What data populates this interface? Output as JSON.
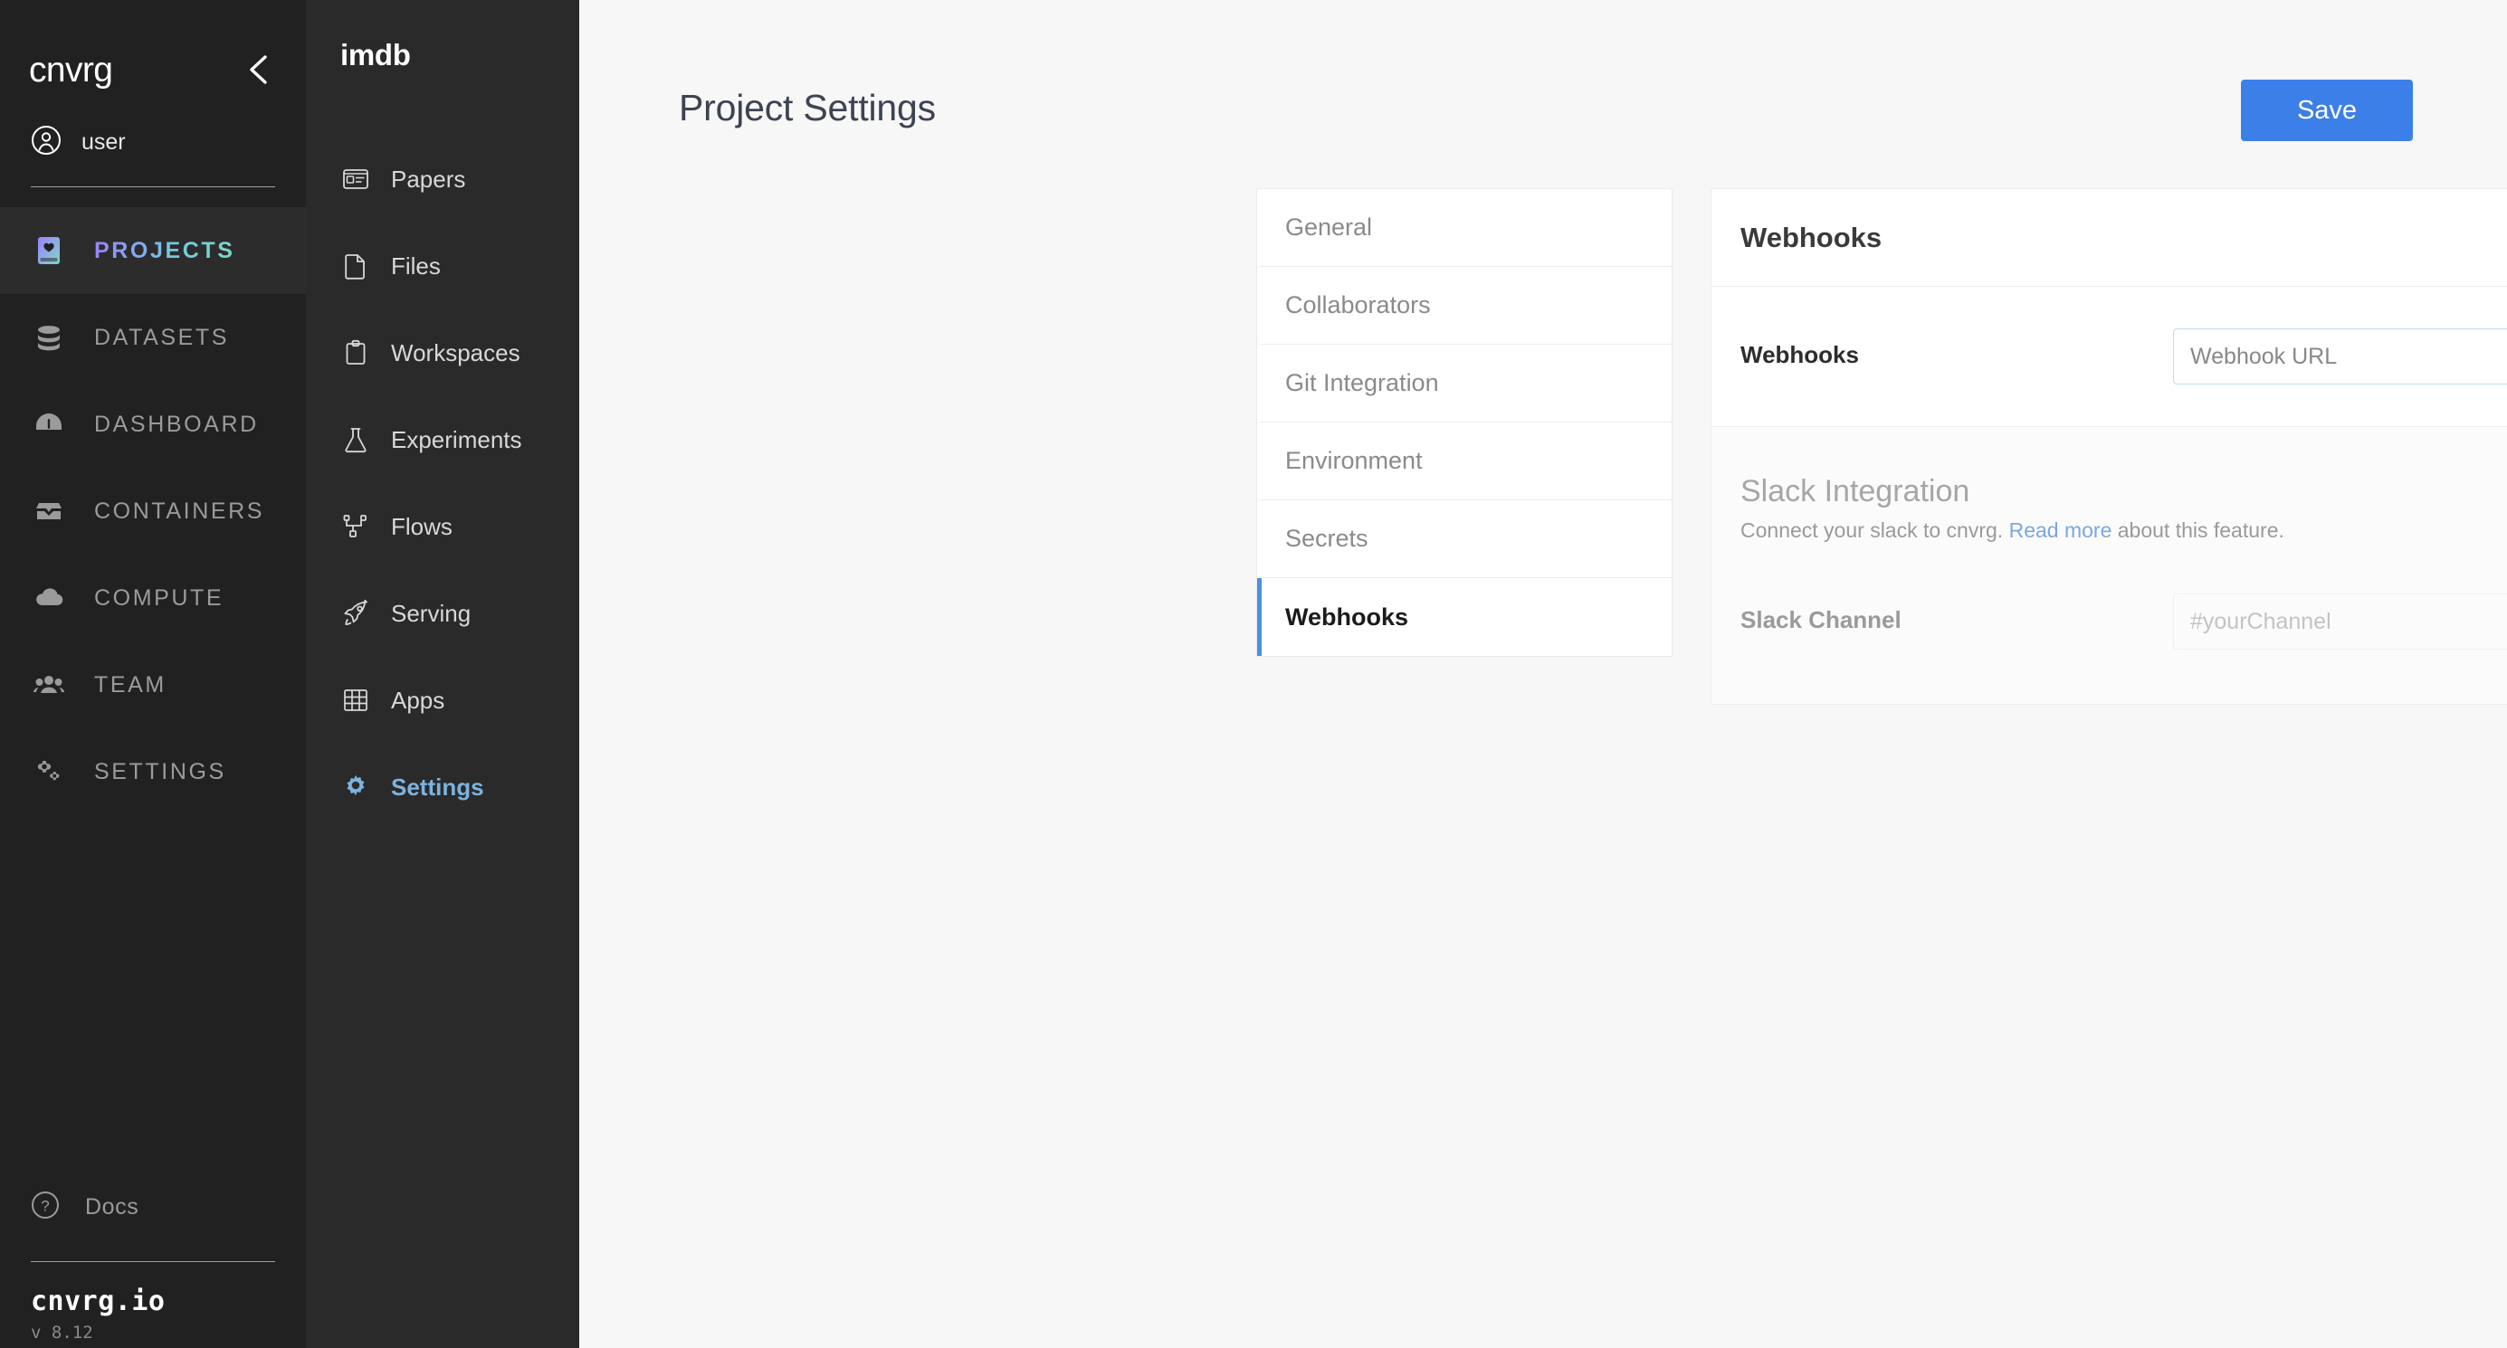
{
  "primary_nav": {
    "brand": "cnvrg",
    "collapse_icon": "chevron-left-icon",
    "user": {
      "icon": "user-circle-icon",
      "name": "user"
    },
    "items": [
      {
        "label": "PROJECTS",
        "icon": "book-heart-icon",
        "active": true
      },
      {
        "label": "DATASETS",
        "icon": "database-icon",
        "active": false
      },
      {
        "label": "DASHBOARD",
        "icon": "gauge-icon",
        "active": false
      },
      {
        "label": "CONTAINERS",
        "icon": "open-box-icon",
        "active": false
      },
      {
        "label": "COMPUTE",
        "icon": "cloud-icon",
        "active": false
      },
      {
        "label": "TEAM",
        "icon": "people-icon",
        "active": false
      },
      {
        "label": "SETTINGS",
        "icon": "gears-icon",
        "active": false
      }
    ],
    "docs": {
      "label": "Docs",
      "icon": "question-circle-icon"
    },
    "site_url": "cnvrg.io",
    "version": "v 8.12"
  },
  "project_nav": {
    "project_name": "imdb",
    "items": [
      {
        "label": "Papers",
        "icon": "article-icon",
        "active": false
      },
      {
        "label": "Files",
        "icon": "file-icon",
        "active": false
      },
      {
        "label": "Workspaces",
        "icon": "clipboard-icon",
        "active": false
      },
      {
        "label": "Experiments",
        "icon": "flask-icon",
        "active": false
      },
      {
        "label": "Flows",
        "icon": "flow-graph-icon",
        "active": false
      },
      {
        "label": "Serving",
        "icon": "rocket-icon",
        "active": false
      },
      {
        "label": "Apps",
        "icon": "grid-icon",
        "active": false
      },
      {
        "label": "Settings",
        "icon": "gear-icon",
        "active": true
      }
    ]
  },
  "header": {
    "title": "Project Settings",
    "save_label": "Save",
    "accent_color": "#3d7fe8"
  },
  "settings_menu": {
    "items": [
      {
        "label": "General",
        "active": false
      },
      {
        "label": "Collaborators",
        "active": false
      },
      {
        "label": "Git Integration",
        "active": false
      },
      {
        "label": "Environment",
        "active": false
      },
      {
        "label": "Secrets",
        "active": false
      },
      {
        "label": "Webhooks",
        "active": true
      }
    ],
    "active_border_color": "#4a90e2"
  },
  "panel": {
    "heading": "Webhooks",
    "webhooks_field": {
      "label": "Webhooks",
      "value": "",
      "placeholder": "Webhook URL"
    },
    "slack": {
      "title": "Slack Integration",
      "desc_before": "Connect your slack to cnvrg. ",
      "link_text": "Read more",
      "desc_after": " about this feature.",
      "link_color": "#7aa8e0",
      "toggle_state": "off",
      "channel_label": "Slack Channel",
      "channel_value": "",
      "channel_placeholder": "#yourChannel",
      "channel_disabled": true
    }
  }
}
